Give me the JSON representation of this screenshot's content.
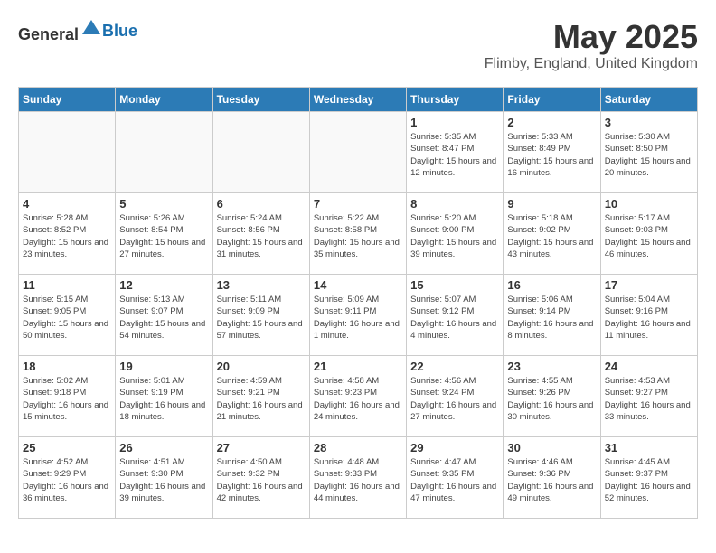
{
  "header": {
    "logo_general": "General",
    "logo_blue": "Blue",
    "title": "May 2025",
    "subtitle": "Flimby, England, United Kingdom"
  },
  "weekdays": [
    "Sunday",
    "Monday",
    "Tuesday",
    "Wednesday",
    "Thursday",
    "Friday",
    "Saturday"
  ],
  "weeks": [
    [
      {
        "day": "",
        "info": ""
      },
      {
        "day": "",
        "info": ""
      },
      {
        "day": "",
        "info": ""
      },
      {
        "day": "",
        "info": ""
      },
      {
        "day": "1",
        "info": "Sunrise: 5:35 AM\nSunset: 8:47 PM\nDaylight: 15 hours\nand 12 minutes."
      },
      {
        "day": "2",
        "info": "Sunrise: 5:33 AM\nSunset: 8:49 PM\nDaylight: 15 hours\nand 16 minutes."
      },
      {
        "day": "3",
        "info": "Sunrise: 5:30 AM\nSunset: 8:50 PM\nDaylight: 15 hours\nand 20 minutes."
      }
    ],
    [
      {
        "day": "4",
        "info": "Sunrise: 5:28 AM\nSunset: 8:52 PM\nDaylight: 15 hours\nand 23 minutes."
      },
      {
        "day": "5",
        "info": "Sunrise: 5:26 AM\nSunset: 8:54 PM\nDaylight: 15 hours\nand 27 minutes."
      },
      {
        "day": "6",
        "info": "Sunrise: 5:24 AM\nSunset: 8:56 PM\nDaylight: 15 hours\nand 31 minutes."
      },
      {
        "day": "7",
        "info": "Sunrise: 5:22 AM\nSunset: 8:58 PM\nDaylight: 15 hours\nand 35 minutes."
      },
      {
        "day": "8",
        "info": "Sunrise: 5:20 AM\nSunset: 9:00 PM\nDaylight: 15 hours\nand 39 minutes."
      },
      {
        "day": "9",
        "info": "Sunrise: 5:18 AM\nSunset: 9:02 PM\nDaylight: 15 hours\nand 43 minutes."
      },
      {
        "day": "10",
        "info": "Sunrise: 5:17 AM\nSunset: 9:03 PM\nDaylight: 15 hours\nand 46 minutes."
      }
    ],
    [
      {
        "day": "11",
        "info": "Sunrise: 5:15 AM\nSunset: 9:05 PM\nDaylight: 15 hours\nand 50 minutes."
      },
      {
        "day": "12",
        "info": "Sunrise: 5:13 AM\nSunset: 9:07 PM\nDaylight: 15 hours\nand 54 minutes."
      },
      {
        "day": "13",
        "info": "Sunrise: 5:11 AM\nSunset: 9:09 PM\nDaylight: 15 hours\nand 57 minutes."
      },
      {
        "day": "14",
        "info": "Sunrise: 5:09 AM\nSunset: 9:11 PM\nDaylight: 16 hours\nand 1 minute."
      },
      {
        "day": "15",
        "info": "Sunrise: 5:07 AM\nSunset: 9:12 PM\nDaylight: 16 hours\nand 4 minutes."
      },
      {
        "day": "16",
        "info": "Sunrise: 5:06 AM\nSunset: 9:14 PM\nDaylight: 16 hours\nand 8 minutes."
      },
      {
        "day": "17",
        "info": "Sunrise: 5:04 AM\nSunset: 9:16 PM\nDaylight: 16 hours\nand 11 minutes."
      }
    ],
    [
      {
        "day": "18",
        "info": "Sunrise: 5:02 AM\nSunset: 9:18 PM\nDaylight: 16 hours\nand 15 minutes."
      },
      {
        "day": "19",
        "info": "Sunrise: 5:01 AM\nSunset: 9:19 PM\nDaylight: 16 hours\nand 18 minutes."
      },
      {
        "day": "20",
        "info": "Sunrise: 4:59 AM\nSunset: 9:21 PM\nDaylight: 16 hours\nand 21 minutes."
      },
      {
        "day": "21",
        "info": "Sunrise: 4:58 AM\nSunset: 9:23 PM\nDaylight: 16 hours\nand 24 minutes."
      },
      {
        "day": "22",
        "info": "Sunrise: 4:56 AM\nSunset: 9:24 PM\nDaylight: 16 hours\nand 27 minutes."
      },
      {
        "day": "23",
        "info": "Sunrise: 4:55 AM\nSunset: 9:26 PM\nDaylight: 16 hours\nand 30 minutes."
      },
      {
        "day": "24",
        "info": "Sunrise: 4:53 AM\nSunset: 9:27 PM\nDaylight: 16 hours\nand 33 minutes."
      }
    ],
    [
      {
        "day": "25",
        "info": "Sunrise: 4:52 AM\nSunset: 9:29 PM\nDaylight: 16 hours\nand 36 minutes."
      },
      {
        "day": "26",
        "info": "Sunrise: 4:51 AM\nSunset: 9:30 PM\nDaylight: 16 hours\nand 39 minutes."
      },
      {
        "day": "27",
        "info": "Sunrise: 4:50 AM\nSunset: 9:32 PM\nDaylight: 16 hours\nand 42 minutes."
      },
      {
        "day": "28",
        "info": "Sunrise: 4:48 AM\nSunset: 9:33 PM\nDaylight: 16 hours\nand 44 minutes."
      },
      {
        "day": "29",
        "info": "Sunrise: 4:47 AM\nSunset: 9:35 PM\nDaylight: 16 hours\nand 47 minutes."
      },
      {
        "day": "30",
        "info": "Sunrise: 4:46 AM\nSunset: 9:36 PM\nDaylight: 16 hours\nand 49 minutes."
      },
      {
        "day": "31",
        "info": "Sunrise: 4:45 AM\nSunset: 9:37 PM\nDaylight: 16 hours\nand 52 minutes."
      }
    ]
  ]
}
